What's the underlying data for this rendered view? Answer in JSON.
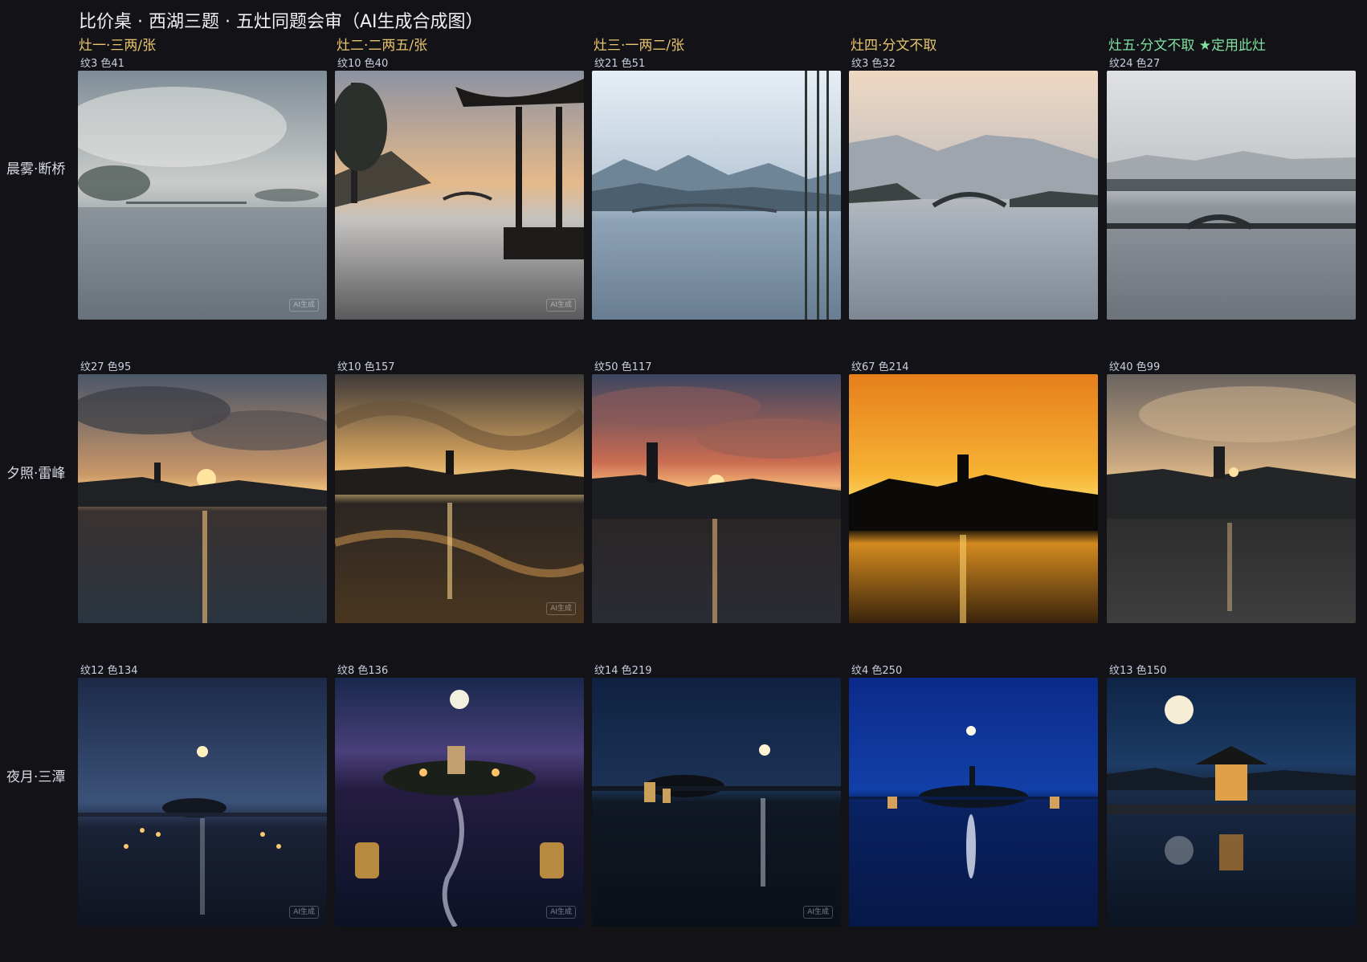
{
  "page": {
    "title": "比价桌 · 西湖三题 · 五灶同题会审（AI生成合成图）"
  },
  "columns": [
    {
      "label": "灶一·三两/张"
    },
    {
      "label": "灶二·二两五/张"
    },
    {
      "label": "灶三·一两二/张"
    },
    {
      "label": "灶四·分文不取"
    },
    {
      "label": "灶五·分文不取 ★定用此灶"
    }
  ],
  "rows": [
    {
      "label": "晨雾·断桥",
      "cells": [
        {
          "metric": "纹3 色41",
          "watermark": "AI生成"
        },
        {
          "metric": "纹10 色40",
          "watermark": "AI生成"
        },
        {
          "metric": "纹21 色51",
          "watermark": ""
        },
        {
          "metric": "纹3 色32",
          "watermark": ""
        },
        {
          "metric": "纹24 色27",
          "watermark": ""
        }
      ]
    },
    {
      "label": "夕照·雷峰",
      "cells": [
        {
          "metric": "纹27 色95",
          "watermark": ""
        },
        {
          "metric": "纹10 色157",
          "watermark": "AI生成"
        },
        {
          "metric": "纹50 色117",
          "watermark": ""
        },
        {
          "metric": "纹67 色214",
          "watermark": ""
        },
        {
          "metric": "纹40 色99",
          "watermark": ""
        }
      ]
    },
    {
      "label": "夜月·三潭",
      "cells": [
        {
          "metric": "纹12 色134",
          "watermark": "AI生成"
        },
        {
          "metric": "纹8 色136",
          "watermark": "AI生成"
        },
        {
          "metric": "纹14 色219",
          "watermark": "AI生成"
        },
        {
          "metric": "纹4 色250",
          "watermark": ""
        },
        {
          "metric": "纹13 色150",
          "watermark": ""
        }
      ]
    }
  ],
  "colors": {
    "background": "#131317",
    "header": "#e7c56e",
    "chosen": "#7fe0a0"
  }
}
